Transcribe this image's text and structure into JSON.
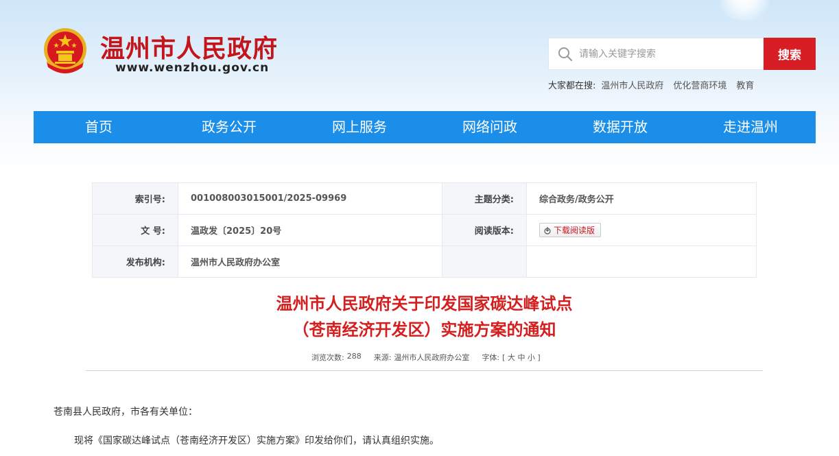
{
  "header": {
    "site_name": "温州市人民政府",
    "site_url": "www.wenzhou.gov.cn"
  },
  "search": {
    "placeholder": "请输入关键字搜索",
    "button_label": "搜索",
    "hot_label": "大家都在搜:",
    "hot_terms": [
      "温州市人民政府",
      "优化营商环境",
      "教育"
    ]
  },
  "nav": {
    "items": [
      "首页",
      "政务公开",
      "网上服务",
      "网络问政",
      "数据开放",
      "走进温州"
    ]
  },
  "meta": {
    "index_label": "索引号:",
    "index_value": "001008003015001/2025-09969",
    "topic_label": "主题分类:",
    "topic_value": "综合政务/政务公开",
    "doc_no_label": "文 号:",
    "doc_no_value": "温政发〔2025〕20号",
    "read_label": "阅读版本:",
    "download_label": "下载阅读版",
    "issuer_label": "发布机构:",
    "issuer_value": "温州市人民政府办公室"
  },
  "article": {
    "title_line1": "温州市人民政府关于印发国家碳达峰试点",
    "title_line2": "（苍南经济开发区）实施方案的通知",
    "views_label": "浏览次数:",
    "views_value": "288",
    "source_label": "来源:",
    "source_value": "温州市人民政府办公室",
    "font_label": "字体:",
    "font_options": "[ 大 中 小 ]",
    "salutation": "苍南县人民政府，市各有关单位：",
    "body_line1": "现将《国家碳达峰试点（苍南经济开发区）实施方案》印发给你们，请认真组织实施。"
  },
  "colors": {
    "brand_red": "#c4151c",
    "nav_blue": "#1a8ee8",
    "title_red": "#d51f1f"
  }
}
